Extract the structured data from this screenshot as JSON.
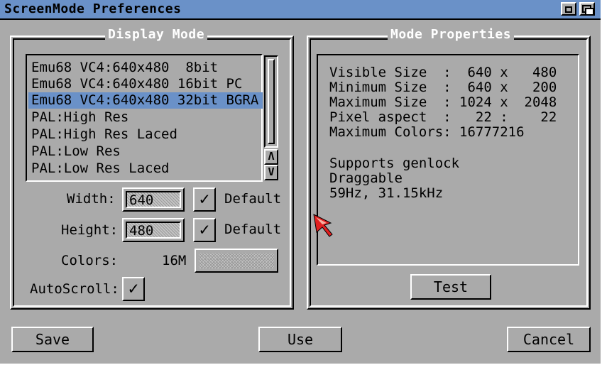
{
  "window": {
    "title": "ScreenMode Preferences"
  },
  "display_mode": {
    "title": "Display Mode",
    "modes": [
      "Emu68 VC4:640x480  8bit",
      "Emu68 VC4:640x480 16bit PC",
      "Emu68 VC4:640x480 32bit BGRA",
      "PAL:High Res",
      "PAL:High Res Laced",
      "PAL:Low Res",
      "PAL:Low Res Laced"
    ],
    "selected_index": 2,
    "width": {
      "label": "Width:",
      "value": "640",
      "default_label": "Default",
      "default_checked": true
    },
    "height": {
      "label": "Height:",
      "value": "480",
      "default_label": "Default",
      "default_checked": true
    },
    "colors": {
      "label": "Colors:",
      "value": "16M"
    },
    "autoscroll": {
      "label": "AutoScroll:",
      "checked": true
    },
    "check_glyph": "✓",
    "scroll_up_glyph": "Λ",
    "scroll_down_glyph": "V"
  },
  "mode_properties": {
    "title": "Mode Properties",
    "lines": [
      "Visible Size  :  640 x   480",
      "Minimum Size  :  640 x   200",
      "Maximum Size  : 1024 x  2048",
      "Pixel aspect  :   22 :    22",
      "Maximum Colors: 16777216"
    ],
    "features": [
      "Supports genlock",
      "Draggable",
      "59Hz, 31.15kHz"
    ],
    "test_label": "Test"
  },
  "buttons": {
    "save": "Save",
    "use": "Use",
    "cancel": "Cancel"
  },
  "colors": {
    "window_bg": "#aaaaaa",
    "title_bar": "#6a91c8",
    "selection": "#6a91c8",
    "group_title": "#ffffff"
  },
  "icons": [
    "depth-gadget-icon",
    "zoom-gadget-icon",
    "mouse-pointer-icon"
  ]
}
